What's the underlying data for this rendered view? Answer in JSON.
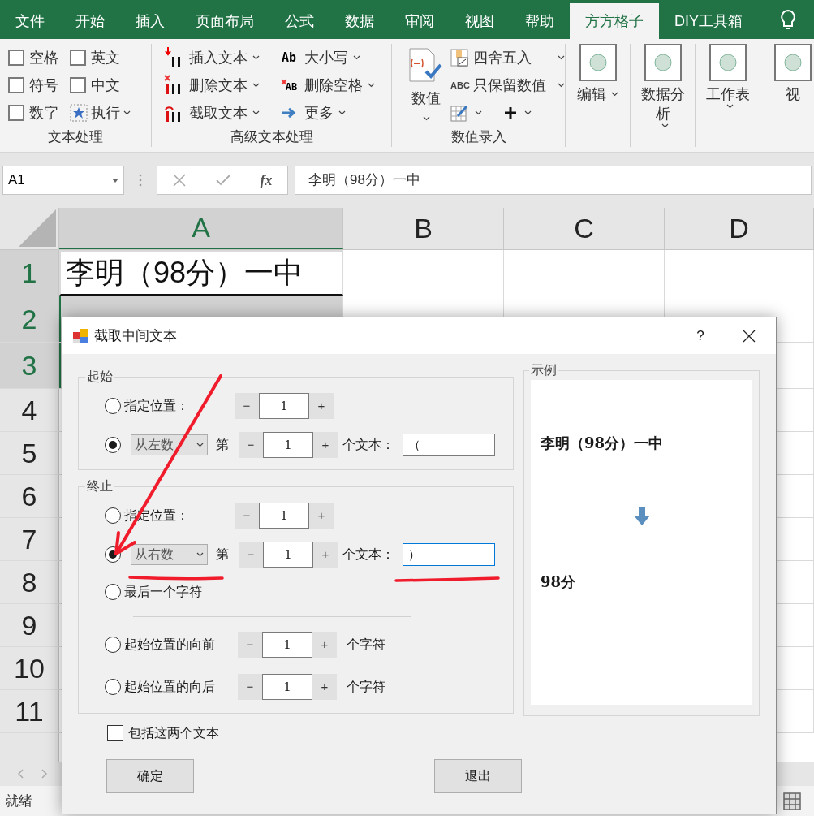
{
  "ribbon_tabs": [
    {
      "label": "文件",
      "selected": false
    },
    {
      "label": "开始",
      "selected": false
    },
    {
      "label": "插入",
      "selected": false
    },
    {
      "label": "页面布局",
      "selected": false
    },
    {
      "label": "公式",
      "selected": false
    },
    {
      "label": "数据",
      "selected": false
    },
    {
      "label": "审阅",
      "selected": false
    },
    {
      "label": "视图",
      "selected": false
    },
    {
      "label": "帮助",
      "selected": false
    },
    {
      "label": "方方格子",
      "selected": true
    },
    {
      "label": "DIY工具箱",
      "selected": false
    }
  ],
  "text_group": {
    "label": "文本处理",
    "items": [
      {
        "kind": "checkbox",
        "label": "空格",
        "checked": false
      },
      {
        "kind": "checkbox",
        "label": "英文",
        "checked": false
      },
      {
        "kind": "checkbox",
        "label": "符号",
        "checked": false
      },
      {
        "kind": "checkbox",
        "label": "中文",
        "checked": false
      },
      {
        "kind": "checkbox",
        "label": "数字",
        "checked": false
      },
      {
        "kind": "menu",
        "label": "执行"
      }
    ]
  },
  "advanced_group": {
    "label": "高级文本处理",
    "items": [
      {
        "label": "插入文本"
      },
      {
        "label": "删除文本"
      },
      {
        "label": "截取文本"
      },
      {
        "label": "大小写",
        "icon_text": "Ab"
      },
      {
        "label": "删除空格",
        "icon_text": "AB"
      },
      {
        "label": "更多"
      }
    ]
  },
  "numeric_group": {
    "label": "数值录入",
    "large": "数值",
    "items": [
      {
        "label": "四舍五入"
      },
      {
        "label": "只保留数值",
        "icon_text": "ABC"
      }
    ]
  },
  "large_buttons": [
    {
      "label": "编辑"
    },
    {
      "label": "数据分析"
    },
    {
      "label": "工作表"
    },
    {
      "label": "视"
    }
  ],
  "formula_bar": {
    "name_box": "A1",
    "fx": "fx",
    "formula": "李明（98分）一中"
  },
  "sheet": {
    "columns": [
      {
        "label": "A",
        "selected": true
      },
      {
        "label": "B",
        "selected": false
      },
      {
        "label": "C",
        "selected": false
      },
      {
        "label": "D",
        "selected": false
      }
    ],
    "rows": [
      {
        "label": "1",
        "selected": true,
        "cell": "李明（98分）一中"
      },
      {
        "label": "2",
        "selected": true
      },
      {
        "label": "3",
        "selected": true
      },
      {
        "label": "4",
        "selected": false
      },
      {
        "label": "5",
        "selected": false
      },
      {
        "label": "6",
        "selected": false
      },
      {
        "label": "7",
        "selected": false
      },
      {
        "label": "8",
        "selected": false
      },
      {
        "label": "9",
        "selected": false
      },
      {
        "label": "10",
        "selected": false
      },
      {
        "label": "11",
        "selected": false
      }
    ]
  },
  "status_bar": {
    "text": "就绪"
  },
  "dialog": {
    "title": "截取中间文本",
    "help": "?",
    "start": {
      "legend": "起始",
      "options": [
        {
          "kind": "position",
          "selected": false,
          "label": "指定位置：",
          "value": "1"
        },
        {
          "kind": "count",
          "selected": true,
          "direction": "从左数",
          "ordinal": "第",
          "value": "1",
          "suffix": "个文本：",
          "text": "（",
          "focused": false
        }
      ]
    },
    "end": {
      "legend": "终止",
      "options": [
        {
          "kind": "position",
          "selected": false,
          "label": "指定位置：",
          "value": "1"
        },
        {
          "kind": "count",
          "selected": true,
          "direction": "从右数",
          "ordinal": "第",
          "value": "1",
          "suffix": "个文本：",
          "text": "）",
          "focused": true
        },
        {
          "kind": "plain",
          "selected": false,
          "label": "最后一个字符"
        },
        {
          "kind": "divider"
        },
        {
          "kind": "offset",
          "selected": false,
          "label": "起始位置的向前",
          "value": "1",
          "suffix": "个字符"
        },
        {
          "kind": "offset",
          "selected": false,
          "label": "起始位置的向后",
          "value": "1",
          "suffix": "个字符"
        }
      ]
    },
    "spin_minus": "−",
    "spin_plus": "+",
    "include": {
      "label": "包括这两个文本",
      "checked": false
    },
    "buttons": [
      "确定",
      "退出"
    ],
    "example": {
      "legend": "示例",
      "source": "李明（98分）一中",
      "result": "98分"
    }
  }
}
